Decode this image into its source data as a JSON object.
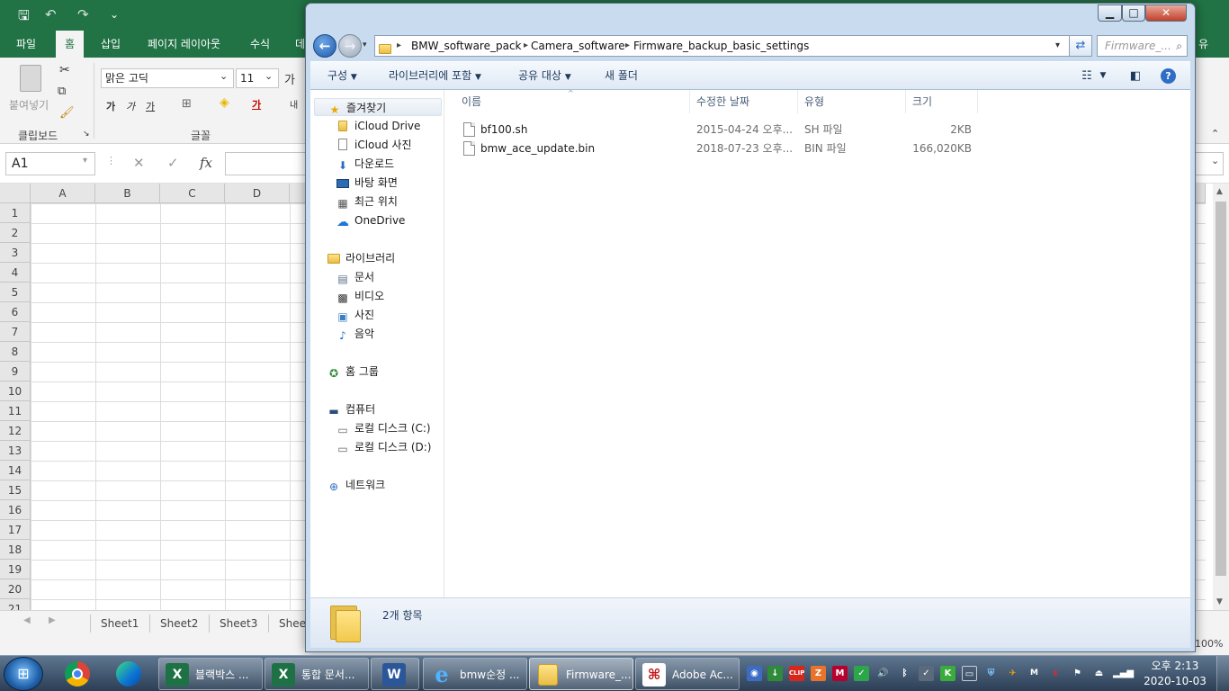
{
  "excel": {
    "quick_access": {
      "save": "🖫",
      "undo": "↶",
      "redo": "↷",
      "more": "⌄"
    },
    "tabs": [
      {
        "label": "파일"
      },
      {
        "label": "홈"
      },
      {
        "label": "삽입"
      },
      {
        "label": "페이지 레이아웃"
      },
      {
        "label": "수식"
      },
      {
        "label": "데"
      },
      {
        "label": "유"
      }
    ],
    "ribbon": {
      "paste_label": "붙여넣기",
      "clipboard_label": "클립보드",
      "font_group_label": "글꼴",
      "font_name": "맑은 고딕",
      "font_size": "11",
      "grow_font": "가",
      "bold": "가",
      "italic": "가",
      "underline": "가",
      "font_color": "가",
      "wrap_hint": "내"
    },
    "name_box": "A1",
    "fx_cancel": "✕",
    "fx_enter": "✓",
    "fx_label": "fx",
    "columns": [
      "A",
      "B",
      "C",
      "D"
    ],
    "rows": [
      "1",
      "2",
      "3",
      "4",
      "5",
      "6",
      "7",
      "8",
      "9",
      "10",
      "11",
      "12",
      "13",
      "14",
      "15",
      "16",
      "17",
      "18",
      "19",
      "20",
      "21"
    ],
    "sheets": [
      "Sheet1",
      "Sheet2",
      "Sheet3",
      "Shee"
    ],
    "zoom": "100%"
  },
  "explorer": {
    "window_title": "",
    "breadcrumbs": [
      "BMW_software_pack",
      "Camera_software",
      "Firmware_backup_basic_settings"
    ],
    "search_placeholder": "Firmware_...",
    "toolbar": {
      "organize": "구성",
      "include_in_library": "라이브러리에 포함",
      "share_with": "공유 대상",
      "new_folder": "새 폴더"
    },
    "nav_tree": {
      "favorites": "즐겨찾기",
      "favorites_items": [
        "iCloud Drive",
        "iCloud 사진",
        "다운로드",
        "바탕 화면",
        "최근 위치",
        "OneDrive"
      ],
      "libraries": "라이브러리",
      "libraries_items": [
        "문서",
        "비디오",
        "사진",
        "음악"
      ],
      "homegroup": "홈 그룹",
      "computer": "컴퓨터",
      "computer_items": [
        "로컬 디스크 (C:)",
        "로컬 디스크 (D:)"
      ],
      "network": "네트워크"
    },
    "columns": {
      "name": "이름",
      "modified": "수정한 날짜",
      "type": "유형",
      "size": "크기"
    },
    "files": [
      {
        "name": "bf100.sh",
        "modified": "2015-04-24 오후...",
        "type": "SH 파일",
        "size": "2KB"
      },
      {
        "name": "bmw_ace_update.bin",
        "modified": "2018-07-23 오후...",
        "type": "BIN 파일",
        "size": "166,020KB"
      }
    ],
    "item_count": "2개 항목"
  },
  "taskbar": {
    "apps": [
      {
        "label": "블랙박스 ...",
        "icon": "excel-icon"
      },
      {
        "label": "통합 문서...",
        "icon": "excel-icon"
      },
      {
        "label": "",
        "icon": "word-icon"
      },
      {
        "label": "bmw순정 ...",
        "icon": "ie-icon"
      },
      {
        "label": "Firmware_...",
        "icon": "folder-icon"
      },
      {
        "label": "Adobe Ac...",
        "icon": "acrobat-icon"
      }
    ],
    "clock_time": "오후 2:13",
    "clock_date": "2020-10-03"
  },
  "colors": {
    "excel_green": "#217346",
    "explorer_frame": "#c9dcef",
    "taskbar": "#2b3e55"
  }
}
